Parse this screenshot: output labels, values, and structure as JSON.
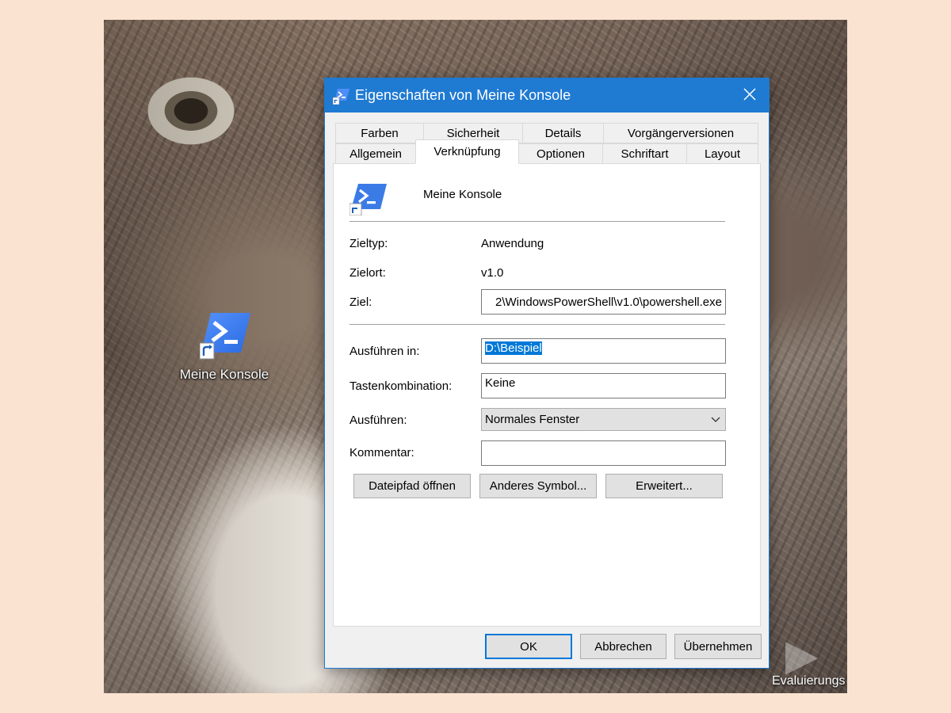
{
  "desktop": {
    "shortcut_label": "Meine Konsole",
    "watermark": "Evaluierungs"
  },
  "dialog": {
    "title": "Eigenschaften von Meine Konsole",
    "tabs_row1": [
      "Farben",
      "Sicherheit",
      "Details",
      "Vorgängerversionen"
    ],
    "tabs_row2": [
      "Allgemein",
      "Verknüpfung",
      "Optionen",
      "Schriftart",
      "Layout"
    ],
    "active_tab": "Verknüpfung",
    "shortcut_name": "Meine Konsole",
    "zieltyp_label": "Zieltyp:",
    "zieltyp_value": "Anwendung",
    "zielort_label": "Zielort:",
    "zielort_value": "v1.0",
    "ziel_label": "Ziel:",
    "ziel_value": "2\\WindowsPowerShell\\v1.0\\powershell.exe",
    "ausfuehren_in_label": "Ausführen in:",
    "ausfuehren_in_value": "D:\\Beispiel",
    "tastenkombination_label": "Tastenkombination:",
    "tastenkombination_value": "Keine",
    "ausfuehren_label": "Ausführen:",
    "ausfuehren_value": "Normales Fenster",
    "kommentar_label": "Kommentar:",
    "kommentar_value": "",
    "buttons": {
      "open_path": "Dateipfad öffnen",
      "change_icon": "Anderes Symbol...",
      "advanced": "Erweitert...",
      "ok": "OK",
      "cancel": "Abbrechen",
      "apply": "Übernehmen"
    }
  },
  "colors": {
    "accent": "#1f7ad2",
    "selection": "#0078d7",
    "page_bg": "#fbe3d2"
  },
  "icons": {
    "app": "powershell-icon",
    "shortcut_overlay": "shortcut-arrow-icon",
    "close": "close-icon",
    "dropdown": "chevron-down-icon"
  }
}
